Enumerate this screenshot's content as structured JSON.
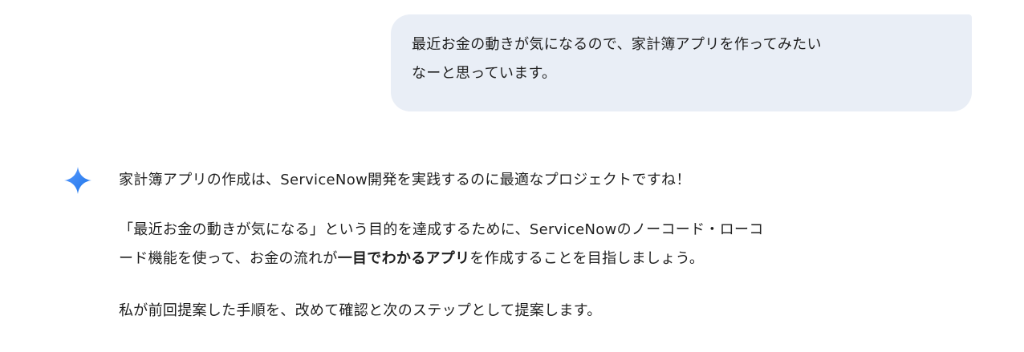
{
  "user_message": {
    "line1": "最近お金の動きが気になるので、家計簿アプリを作ってみたい",
    "line2": "なーと思っています。"
  },
  "model_response": {
    "icon": "gemini-sparkle-icon",
    "para1": "家計簿アプリの作成は、ServiceNow開発を実践するのに最適なプロジェクトですね！",
    "para2_line1": "「最近お金の動きが気になる」という目的を達成するために、ServiceNowのノーコード・ローコ",
    "para2_line2_prefix": "ード機能を使って、お金の流れが",
    "para2_bold": "一目でわかるアプリ",
    "para2_line2_suffix": "を作成することを目指しましょう。",
    "para3": "私が前回提案した手順を、改めて確認と次のステップとして提案します。"
  },
  "colors": {
    "user_bubble_bg": "#e9eef6",
    "text": "#1f1f1f",
    "spark_gradient_start": "#4285f4",
    "spark_gradient_end": "#1a73e8"
  }
}
